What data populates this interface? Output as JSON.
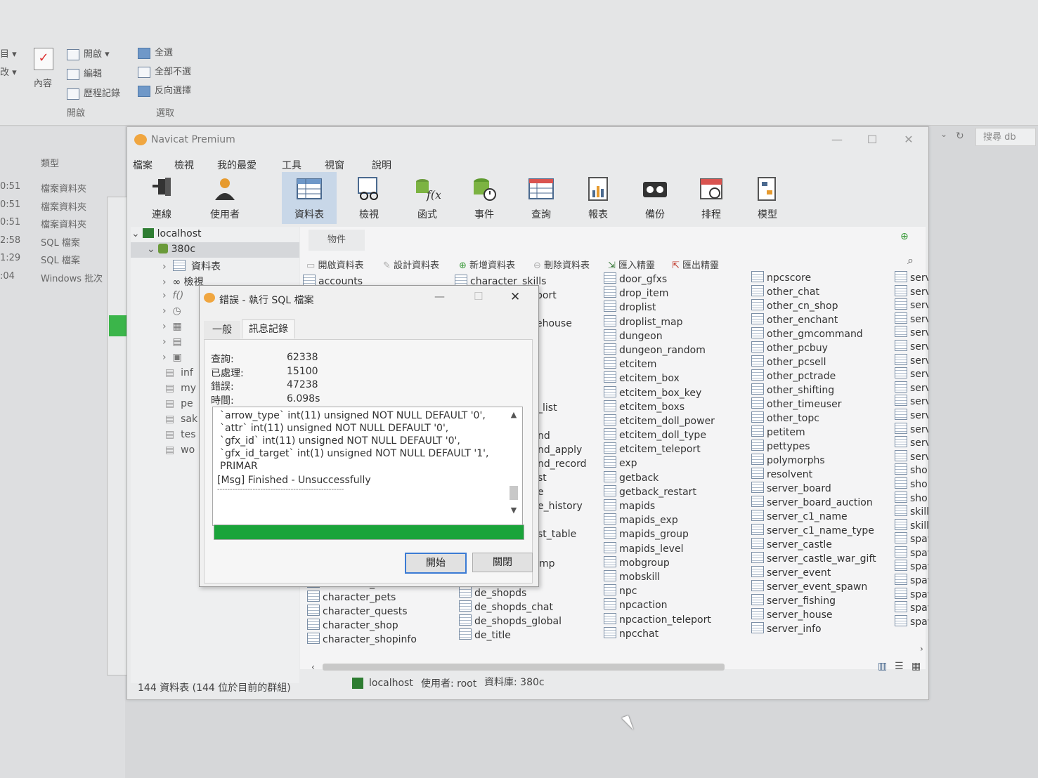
{
  "explorer": {
    "ribbon": {
      "open_group": {
        "items": [
          "開啟",
          "編輯",
          "歷程記錄"
        ],
        "label": "開啟"
      },
      "content_label": "內容",
      "select_group": {
        "items": [
          "全選",
          "全部不選",
          "反向選擇"
        ],
        "label": "選取"
      }
    },
    "search_placeholder": "搜尋 db",
    "type_header": "類型",
    "rows": [
      {
        "time": "0:51",
        "type": "檔案資料夾"
      },
      {
        "time": "0:51",
        "type": "檔案資料夾"
      },
      {
        "time": "0:51",
        "type": "檔案資料夾"
      },
      {
        "time": "2:58",
        "type": "SQL 檔案"
      },
      {
        "time": "1:29",
        "type": "SQL 檔案"
      },
      {
        "time": ":04",
        "type": "Windows 批次"
      }
    ]
  },
  "navicat": {
    "title": "Navicat Premium",
    "menu": [
      "檔案",
      "檢視",
      "我的最愛",
      "工具",
      "視窗",
      "說明"
    ],
    "toolbar": [
      {
        "label": "連線",
        "icon": "plug-icon"
      },
      {
        "label": "使用者",
        "icon": "user-icon"
      },
      {
        "label": "資料表",
        "icon": "table-icon",
        "active": true
      },
      {
        "label": "檢視",
        "icon": "view-icon"
      },
      {
        "label": "函式",
        "icon": "function-icon"
      },
      {
        "label": "事件",
        "icon": "event-icon"
      },
      {
        "label": "查詢",
        "icon": "query-icon"
      },
      {
        "label": "報表",
        "icon": "report-icon"
      },
      {
        "label": "備份",
        "icon": "backup-icon"
      },
      {
        "label": "排程",
        "icon": "schedule-icon"
      },
      {
        "label": "模型",
        "icon": "model-icon"
      }
    ],
    "tree": {
      "connection": "localhost",
      "database": "380c",
      "nodes": [
        "資料表",
        "檢視"
      ],
      "other_dbs": [
        "inf",
        "my",
        "pe",
        "sak",
        "tes",
        "wo"
      ]
    },
    "objects_tab": "物件",
    "object_toolbar": [
      "開啟資料表",
      "設計資料表",
      "新增資料表",
      "刪除資料表",
      "匯入精靈",
      "匯出精靈"
    ],
    "columns": {
      "col1_top": [
        "accounts"
      ],
      "col1_bottom": [
        "character_other",
        "character_pets",
        "character_quests",
        "character_shop",
        "character_shopinfo"
      ],
      "col2_top": [
        "character_skills"
      ],
      "col2_partial": [
        "port",
        "ehouse",
        "_list",
        "nd",
        "nd_apply",
        "nd_record",
        "st",
        "e",
        "e_history",
        "st_table",
        "mp"
      ],
      "col2_bottom": [
        "de_name",
        "de_shopds",
        "de_shopds_chat",
        "de_shopds_global",
        "de_title"
      ],
      "col3": [
        "door_gfxs",
        "drop_item",
        "droplist",
        "droplist_map",
        "dungeon",
        "dungeon_random",
        "etcitem",
        "etcitem_box",
        "etcitem_box_key",
        "etcitem_boxs",
        "etcitem_doll_power",
        "etcitem_doll_type",
        "etcitem_teleport",
        "exp",
        "getback",
        "getback_restart",
        "mapids",
        "mapids_exp",
        "mapids_group",
        "mapids_level",
        "mobgroup",
        "mobskill",
        "npc",
        "npcaction",
        "npcaction_teleport",
        "npcchat"
      ],
      "col4": [
        "npcscore",
        "other_chat",
        "other_cn_shop",
        "other_enchant",
        "other_gmcommand",
        "other_pcbuy",
        "other_pcsell",
        "other_pctrade",
        "other_shifting",
        "other_timeuser",
        "other_topc",
        "petitem",
        "pettypes",
        "polymorphs",
        "resolvent",
        "server_board",
        "server_board_auction",
        "server_c1_name",
        "server_c1_name_type",
        "server_castle",
        "server_castle_war_gift",
        "server_event",
        "server_event_spawn",
        "server_fishing",
        "server_house",
        "server_info"
      ],
      "col5": [
        "serve",
        "serve",
        "serve",
        "serve",
        "serve",
        "serve",
        "serve",
        "serve",
        "serve",
        "serve",
        "serve",
        "serve",
        "serve",
        "serve",
        "shop",
        "shop",
        "shop",
        "skills",
        "skills",
        "spaw",
        "spaw",
        "spaw",
        "spaw",
        "spaw",
        "spaw",
        "spaw"
      ]
    },
    "status": {
      "count": "144 資料表 (144 位於目前的群組)",
      "connection": "localhost",
      "user": "使用者: root",
      "db": "資料庫: 380c"
    }
  },
  "dialog": {
    "title": "錯誤 - 執行 SQL 檔案",
    "tabs": [
      "一般",
      "訊息記錄"
    ],
    "stats": [
      {
        "label": "查詢:",
        "value": "62338"
      },
      {
        "label": "已處理:",
        "value": "15100"
      },
      {
        "label": "錯誤:",
        "value": "47238"
      },
      {
        "label": "時間:",
        "value": "6.098s"
      }
    ],
    "log": [
      "`arrow_type` int(11) unsigned NOT NULL DEFAULT '0',",
      "`attr` int(11) unsigned NOT NULL DEFAULT '0',",
      "`gfx_id` int(11) unsigned NOT NULL DEFAULT '0',",
      "`gfx_id_target` int(1) unsigned NOT NULL DEFAULT '1',",
      "PRIMAR",
      "[Msg] Finished - Unsuccessfully",
      "--------------------------------------------------"
    ],
    "progress": 1.0,
    "start_button": "開始",
    "close_button": "關閉"
  }
}
